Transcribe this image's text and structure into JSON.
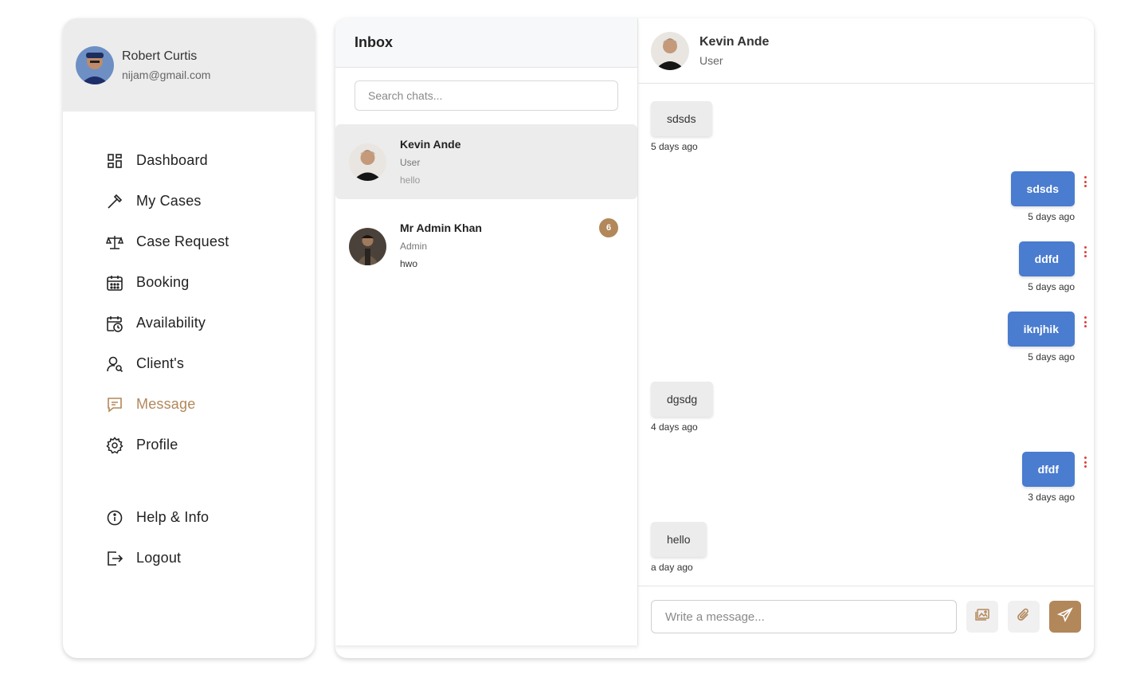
{
  "user": {
    "name": "Robert Curtis",
    "email": "nijam@gmail.com"
  },
  "nav": [
    {
      "label": "Dashboard",
      "icon": "dashboard-icon"
    },
    {
      "label": "My Cases",
      "icon": "hammer-icon"
    },
    {
      "label": "Case Request",
      "icon": "scales-icon"
    },
    {
      "label": "Booking",
      "icon": "calendar-icon"
    },
    {
      "label": "Availability",
      "icon": "calendar-clock-icon"
    },
    {
      "label": "Client's",
      "icon": "user-search-icon"
    },
    {
      "label": "Message",
      "icon": "message-icon",
      "active": true
    },
    {
      "label": "Profile",
      "icon": "gear-icon"
    }
  ],
  "nav_bottom": [
    {
      "label": "Help & Info",
      "icon": "info-icon"
    },
    {
      "label": "Logout",
      "icon": "logout-icon"
    }
  ],
  "inbox": {
    "title": "Inbox",
    "search_placeholder": "Search chats...",
    "chats": [
      {
        "name": "Kevin Ande",
        "role": "User",
        "last": "hello"
      },
      {
        "name": "Mr Admin Khan",
        "role": "Admin",
        "last": "hwo",
        "unread": "6"
      }
    ]
  },
  "conversation": {
    "name": "Kevin Ande",
    "role": "User",
    "messages": [
      {
        "text": "sdsds",
        "time": "5 days ago",
        "dir": "in"
      },
      {
        "text": "sdsds",
        "time": "5 days ago",
        "dir": "out"
      },
      {
        "text": "ddfd",
        "time": "5 days ago",
        "dir": "out"
      },
      {
        "text": "iknjhik",
        "time": "5 days ago",
        "dir": "out"
      },
      {
        "text": "dgsdg",
        "time": "4 days ago",
        "dir": "in"
      },
      {
        "text": "dfdf",
        "time": "3 days ago",
        "dir": "out"
      },
      {
        "text": "hello",
        "time": "a day ago",
        "dir": "in"
      }
    ],
    "input_placeholder": "Write a message..."
  },
  "colors": {
    "accent": "#b2875a",
    "outgoing": "#4a7ccf",
    "incoming": "#ececec",
    "menu_dots": "#e0413a"
  }
}
